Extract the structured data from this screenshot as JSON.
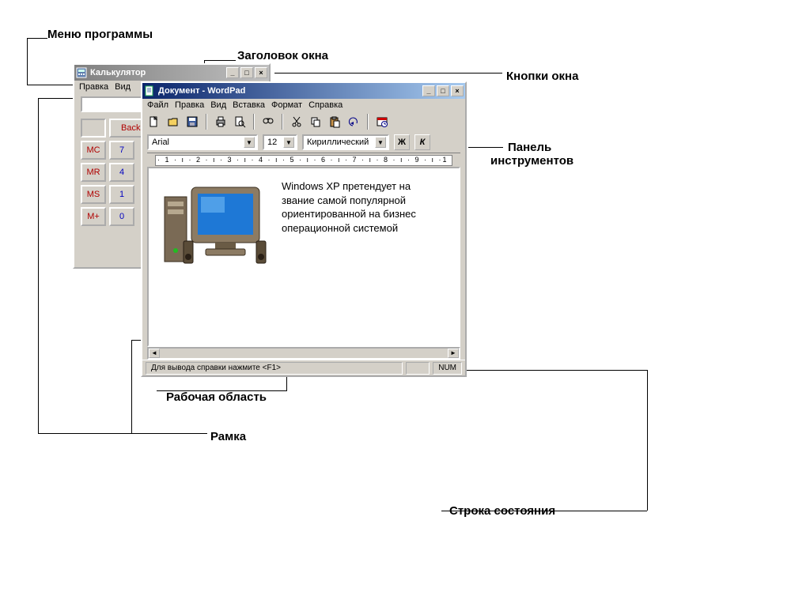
{
  "labels": {
    "menu_program": "Меню программы",
    "window_title": "Заголовок окна",
    "window_buttons": "Кнопки окна",
    "toolbar_panel": "Панель",
    "toolbar_panel2": "инструментов",
    "work_area": "Рабочая область",
    "frame": "Рамка",
    "status_line": "Строка состояния"
  },
  "calculator": {
    "title": "Калькулятор",
    "menu": [
      "Правка",
      "Вид"
    ],
    "backspace": "Backs",
    "mem_buttons": [
      "MC",
      "MR",
      "MS",
      "M+"
    ],
    "num_col": [
      "7",
      "4",
      "1",
      "0"
    ]
  },
  "wordpad": {
    "title": "Документ - WordPad",
    "menu": [
      "Файл",
      "Правка",
      "Вид",
      "Вставка",
      "Формат",
      "Справка"
    ],
    "font_name": "Arial",
    "font_size": "12",
    "font_script": "Кириллический",
    "ruler_text": "· 1 · ı · 2 · ı · 3 · ı · 4 · ı · 5 · ı · 6 · ı · 7 · ı · 8 · ı · 9 · ı ·1",
    "body_text": "Windows XP претендует на звание самой популярной ориентированной на бизнес операционной системой",
    "status_help": "Для вывода справки нажмите <F1>",
    "status_num": "NUM",
    "bold_label": "Ж",
    "italic_label": "К"
  }
}
